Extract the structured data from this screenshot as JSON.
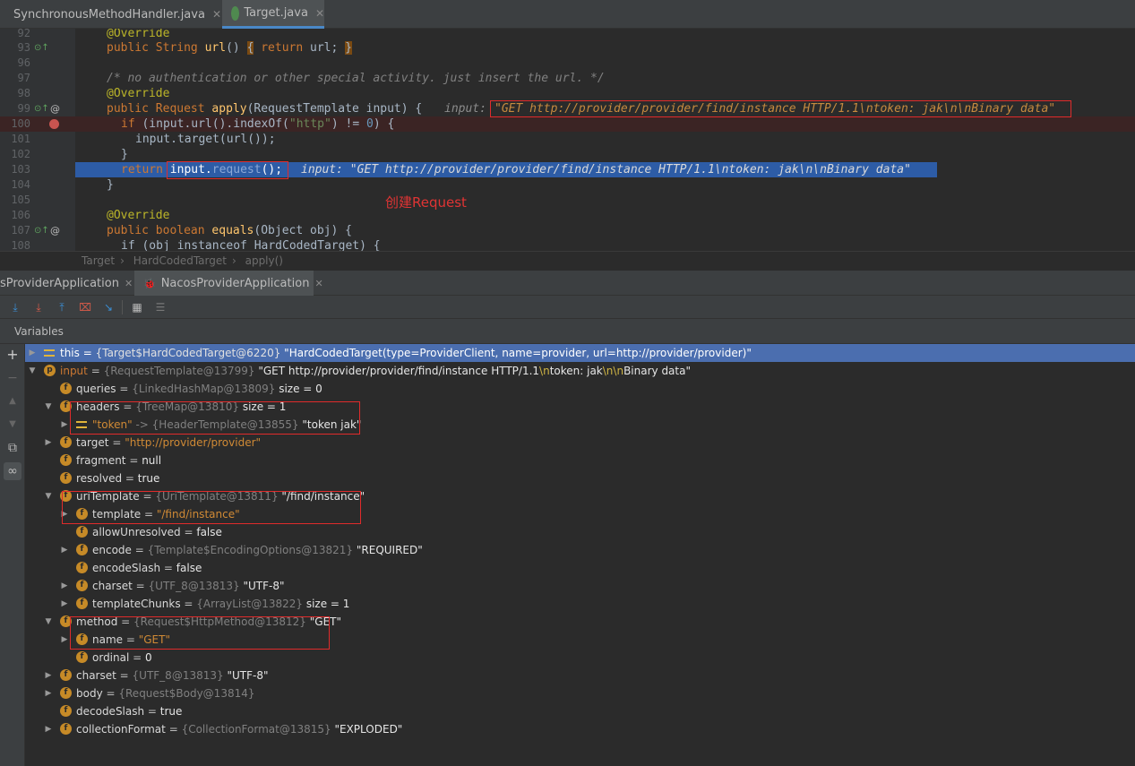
{
  "editor_tabs": [
    {
      "label": "SynchronousMethodHandler.java",
      "icon": "class-icon"
    },
    {
      "label": "Target.java",
      "icon": "interface-icon"
    }
  ],
  "code": {
    "line_numbers": [
      "92",
      "93",
      "96",
      "97",
      "98",
      "99",
      "100",
      "101",
      "102",
      "103",
      "104",
      "105",
      "106",
      "107",
      "108"
    ],
    "l92_annotation": "@Override",
    "l93_kw": "public",
    "l93_type": "String",
    "l93_method": "url",
    "l93_rest": "() ",
    "l93_brace_open": "{",
    "l93_return": "return",
    "l93_body": " url; ",
    "l93_brace_close": "}",
    "l97_comment": "/* no authentication or other special activity. just insert the url. */",
    "l98_annotation": "@Override",
    "l99_kw": "public",
    "l99_type": "Request",
    "l99_method": "apply",
    "l99_params": "(RequestTemplate input) {",
    "l99_hint_label": "input: ",
    "l99_hint_value": "\"GET http://provider/provider/find/instance HTTP/1.1\\ntoken: jak\\n\\nBinary data\"",
    "l100_if": "if",
    "l100_a": " (input.",
    "l100_url": "url",
    "l100_b": "().",
    "l100_indexof": "indexOf",
    "l100_c": "(",
    "l100_str": "\"http\"",
    "l100_d": ") != ",
    "l100_num": "0",
    "l100_e": ") {",
    "l101_code": "input.target(url());",
    "l102_code": "}",
    "l103_return": "return",
    "l103_input": "input.",
    "l103_request": "request",
    "l103_end": "();",
    "l103_hint": "input: \"GET http://provider/provider/find/instance HTTP/1.1\\ntoken: jak\\n\\nBinary data\"",
    "l104_code": "}",
    "l106_annotation": "@Override",
    "l107_kw": "public",
    "l107_type": "boolean",
    "l107_method": "equals",
    "l107_params": "(Object obj) {",
    "l108_code": "if (obj instanceof HardCodedTarget) {"
  },
  "annotation_text": "创建Request",
  "breadcrumb": [
    "Target",
    "HardCodedTarget",
    "apply()"
  ],
  "debug_tabs": [
    {
      "label": "sProviderApplication"
    },
    {
      "label": "NacosProviderApplication"
    }
  ],
  "toolbar_icons": [
    "step-over-icon",
    "step-into-icon",
    "step-out-icon",
    "drop-frame-icon",
    "run-to-cursor-icon",
    "evaluate-icon",
    "trace-icon"
  ],
  "vars_header": "Variables",
  "variables": {
    "this": {
      "name": "this",
      "ref": "{Target$HardCodedTarget@6220}",
      "value": "\"HardCodedTarget(type=ProviderClient, name=provider, url=http://provider/provider)\""
    },
    "input": {
      "name": "input",
      "ref": "{RequestTemplate@13799}",
      "value_a": "\"GET http://provider/provider/find/instance HTTP/1.1",
      "esc1": "\\n",
      "value_b": "token: jak",
      "esc2": "\\n\\n",
      "value_c": "Binary data\""
    },
    "queries": {
      "name": "queries",
      "ref": "{LinkedHashMap@13809}",
      "value": "size = 0"
    },
    "headers": {
      "name": "headers",
      "ref": "{TreeMap@13810}",
      "value": "size = 1"
    },
    "token": {
      "name": "\"token\"",
      "arrow": "->",
      "ref": "{HeaderTemplate@13855}",
      "value": "\"token jak\""
    },
    "target": {
      "name": "target",
      "value": "\"http://provider/provider\""
    },
    "fragment": {
      "name": "fragment",
      "value": "null"
    },
    "resolved": {
      "name": "resolved",
      "value": "true"
    },
    "uriTemplate": {
      "name": "uriTemplate",
      "ref": "{UriTemplate@13811}",
      "value": "\"/find/instance\""
    },
    "template": {
      "name": "template",
      "value": "\"/find/instance\""
    },
    "allowUnresolved": {
      "name": "allowUnresolved",
      "value": "false"
    },
    "encode": {
      "name": "encode",
      "ref": "{Template$EncodingOptions@13821}",
      "value": "\"REQUIRED\""
    },
    "encodeSlash": {
      "name": "encodeSlash",
      "value": "false"
    },
    "charset_inner": {
      "name": "charset",
      "ref": "{UTF_8@13813}",
      "value": "\"UTF-8\""
    },
    "templateChunks": {
      "name": "templateChunks",
      "ref": "{ArrayList@13822}",
      "value": "size = 1"
    },
    "method": {
      "name": "method",
      "ref": "{Request$HttpMethod@13812}",
      "value": "\"GET\""
    },
    "methodName": {
      "name": "name",
      "value": "\"GET\""
    },
    "ordinal": {
      "name": "ordinal",
      "value": "0"
    },
    "charset": {
      "name": "charset",
      "ref": "{UTF_8@13813}",
      "value": "\"UTF-8\""
    },
    "body": {
      "name": "body",
      "ref": "{Request$Body@13814}"
    },
    "decodeSlash": {
      "name": "decodeSlash",
      "value": "true"
    },
    "collectionFormat": {
      "name": "collectionFormat",
      "ref": "{CollectionFormat@13815}",
      "value": "\"EXPLODED\""
    }
  },
  "eq": " = ",
  "f_badge": "f",
  "p_badge": "p",
  "colors": {
    "selection": "#4b6eaf",
    "annotation_red": "#e02b2b",
    "badge": "#c68a27"
  }
}
